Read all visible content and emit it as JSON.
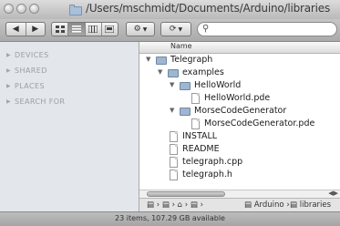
{
  "window": {
    "title_path": "/Users/mschmidt/Documents/Arduino/libraries"
  },
  "toolbar": {
    "back_icon": "◀",
    "forward_icon": "▶",
    "view_icons": [
      "icon-view",
      "list-view",
      "column-view",
      "coverflow-view"
    ],
    "action_icon": "gear-icon",
    "share_icon": "share-icon",
    "search_placeholder": ""
  },
  "sidebar": {
    "headers": [
      {
        "label": "DEVICES"
      },
      {
        "label": "SHARED"
      },
      {
        "label": "PLACES"
      },
      {
        "label": "SEARCH FOR"
      }
    ]
  },
  "list": {
    "column_name": "Name",
    "rows": [
      {
        "label": "Telegraph",
        "kind": "folder",
        "depth": 0,
        "open": true
      },
      {
        "label": "examples",
        "kind": "folder",
        "depth": 1,
        "open": true
      },
      {
        "label": "HelloWorld",
        "kind": "folder",
        "depth": 2,
        "open": true
      },
      {
        "label": "HelloWorld.pde",
        "kind": "file",
        "depth": 3
      },
      {
        "label": "MorseCodeGenerator",
        "kind": "folder",
        "depth": 2,
        "open": true
      },
      {
        "label": "MorseCodeGenerator.pde",
        "kind": "file",
        "depth": 3
      },
      {
        "label": "INSTALL",
        "kind": "file",
        "depth": 1
      },
      {
        "label": "README",
        "kind": "file",
        "depth": 1
      },
      {
        "label": "telegraph.cpp",
        "kind": "file",
        "depth": 1
      },
      {
        "label": "telegraph.h",
        "kind": "file",
        "depth": 1
      }
    ]
  },
  "pathbar": {
    "items": [
      "Arduino",
      "libraries"
    ]
  },
  "status": {
    "text": "23 items, 107.29 GB available"
  }
}
